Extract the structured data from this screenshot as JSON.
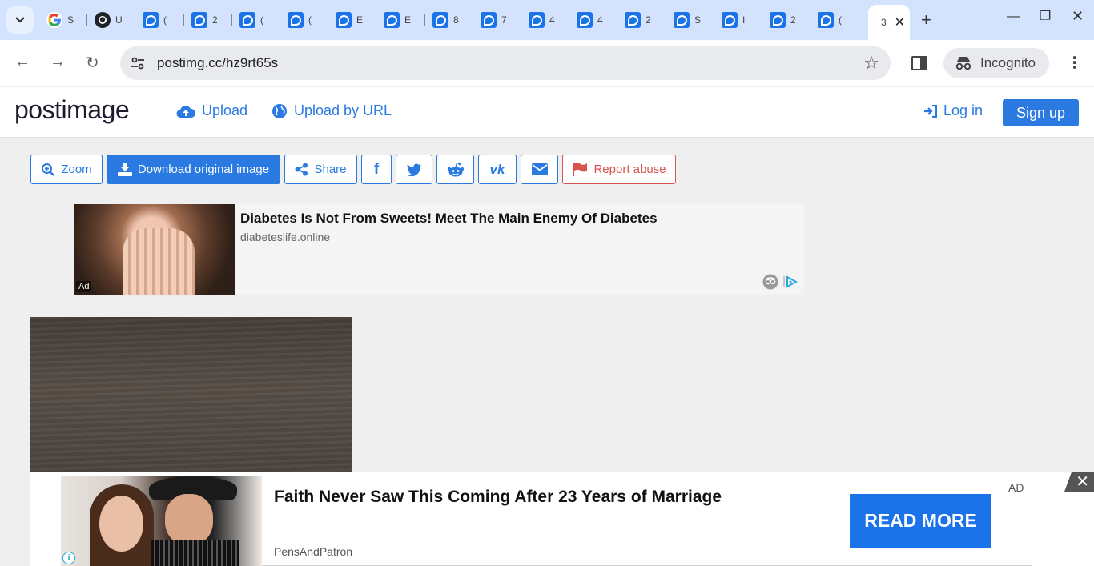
{
  "browser": {
    "tabs": [
      {
        "favicon": "google-icon",
        "title": "S"
      },
      {
        "favicon": "github-icon",
        "title": "U"
      },
      {
        "favicon": "postimage-icon",
        "title": "("
      },
      {
        "favicon": "postimage-icon",
        "title": "2"
      },
      {
        "favicon": "postimage-icon",
        "title": "("
      },
      {
        "favicon": "postimage-icon",
        "title": "("
      },
      {
        "favicon": "postimage-icon",
        "title": "E"
      },
      {
        "favicon": "postimage-icon",
        "title": "E"
      },
      {
        "favicon": "postimage-icon",
        "title": "8"
      },
      {
        "favicon": "postimage-icon",
        "title": "7"
      },
      {
        "favicon": "postimage-icon",
        "title": "4"
      },
      {
        "favicon": "postimage-icon",
        "title": "4"
      },
      {
        "favicon": "postimage-icon",
        "title": "2"
      },
      {
        "favicon": "postimage-icon",
        "title": "S"
      },
      {
        "favicon": "postimage-icon",
        "title": "I"
      },
      {
        "favicon": "postimage-icon",
        "title": "2"
      },
      {
        "favicon": "postimage-icon",
        "title": "("
      }
    ],
    "active_tab_title": "3",
    "url": "postimg.cc/hz9rt65s",
    "incognito_label": "Incognito"
  },
  "site": {
    "logo": "postimage",
    "nav": {
      "upload": "Upload",
      "upload_by_url": "Upload by URL",
      "login": "Log in",
      "signup": "Sign up"
    },
    "actions": {
      "zoom": "Zoom",
      "download": "Download original image",
      "share": "Share",
      "report": "Report abuse"
    }
  },
  "ad_top": {
    "tag": "Ad",
    "headline": "Diabetes Is Not From Sweets! Meet The Main Enemy Of Diabetes",
    "domain": "diabeteslife.online"
  },
  "ad_bottom": {
    "headline": "Faith Never Saw This Coming After 23 Years of Marriage",
    "source": "PensAndPatron",
    "cta": "READ MORE",
    "label": "AD"
  },
  "colors": {
    "accent": "#2a7ae2",
    "danger": "#d9534f",
    "tabstrip": "#d3e3fd"
  }
}
